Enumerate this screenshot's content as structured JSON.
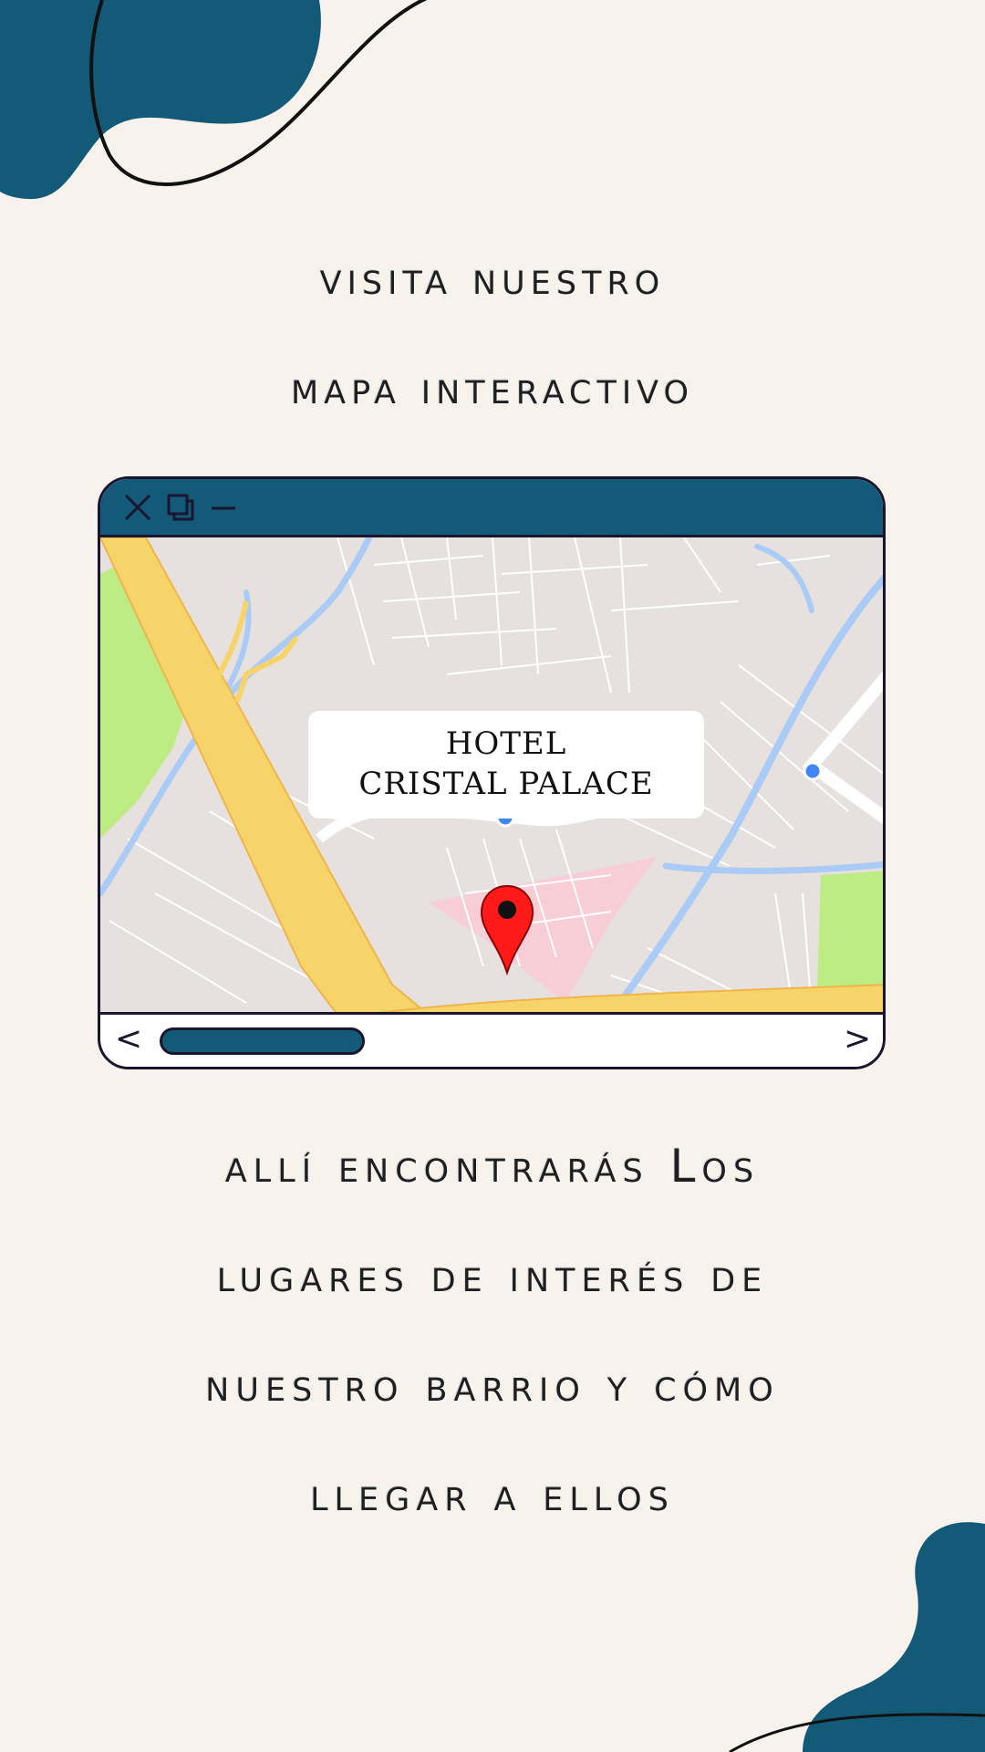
{
  "colors": {
    "background": "#f7f2ec",
    "accent": "#135a78",
    "outline": "#1b1530",
    "map_base": "#e6e1de",
    "highway": "#f6d46a",
    "water": "#aacbf5",
    "park": "#bdec84",
    "zone": "#f7cdd6",
    "pin": "#ff1a1a"
  },
  "heading": {
    "line1": "visita nuestro",
    "line2": "mapa interactivo"
  },
  "window": {
    "icons": [
      "close-icon",
      "restore-icon",
      "minimize-icon"
    ],
    "map": {
      "label_line1": "HOTEL",
      "label_line2": "CRISTAL PALACE",
      "pin_icon": "map-pin-icon"
    },
    "nav": {
      "prev": "<",
      "next": ">"
    }
  },
  "body": {
    "line1": "allí encontrarás Los",
    "line2": "lugares de interés de",
    "line3": "nuestro barrio y cómo",
    "line4": "llegar a ellos"
  }
}
